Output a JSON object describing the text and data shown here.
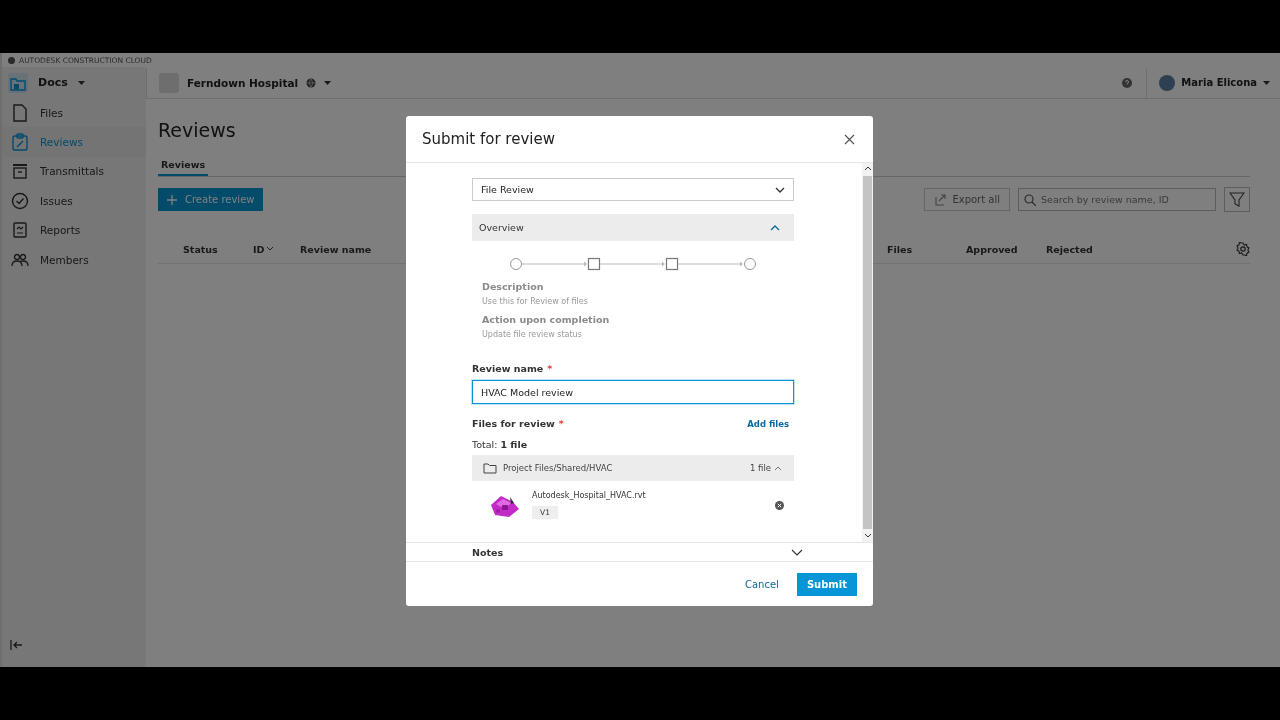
{
  "brand": "AUTODESK CONSTRUCTION CLOUD",
  "header": {
    "module": "Docs",
    "project": "Ferndown Hospital",
    "user": "Maria Elicona"
  },
  "sidebar": {
    "items": [
      {
        "label": "Files",
        "kind": "file",
        "selected": false
      },
      {
        "label": "Reviews",
        "kind": "review",
        "selected": true
      },
      {
        "label": "Transmittals",
        "kind": "transmittal",
        "selected": false
      },
      {
        "label": "Issues",
        "kind": "issue",
        "selected": false
      },
      {
        "label": "Reports",
        "kind": "report",
        "selected": false
      },
      {
        "label": "Members",
        "kind": "members",
        "selected": false
      }
    ]
  },
  "page": {
    "title": "Reviews",
    "tabs": [
      {
        "label": "Reviews",
        "selected": true
      }
    ],
    "create_button": "Create review",
    "export_button": "Export all",
    "search": {
      "placeholder": "Search by review name, ID"
    }
  },
  "table": {
    "columns": [
      {
        "label": "Status",
        "sortable": false
      },
      {
        "label": "ID",
        "sortable": true
      },
      {
        "label": "Review name",
        "sortable": false
      },
      {
        "label": "Files",
        "sortable": false
      },
      {
        "label": "Approved",
        "sortable": false
      },
      {
        "label": "Rejected",
        "sortable": false
      }
    ]
  },
  "dialog": {
    "title": "Submit for review",
    "workflow": "File Review",
    "overview": {
      "title": "Overview",
      "expanded": true,
      "steps": [
        {
          "kind": "circle"
        },
        {
          "kind": "square"
        },
        {
          "kind": "square"
        },
        {
          "kind": "circle"
        }
      ],
      "description_label": "Description",
      "description": "Use this for Review of files",
      "action_label": "Action upon completion",
      "action": "Update file review status"
    },
    "review_name": {
      "label": "Review name",
      "required_mark": "*",
      "value": "HVAC Model review"
    },
    "files": {
      "label": "Files for review",
      "required_mark": "*",
      "add_link": "Add files",
      "total": "Total: **1 file**",
      "folder": {
        "path": "Project Files/Shared/HVAC",
        "count": "1 file",
        "expanded": true
      },
      "items": [
        {
          "name": "Autodesk_Hospital_HVAC.rvt",
          "version": "V1"
        }
      ]
    },
    "notes": {
      "label": "Notes",
      "expanded": false
    },
    "buttons": {
      "cancel": "Cancel",
      "submit": "Submit"
    }
  }
}
